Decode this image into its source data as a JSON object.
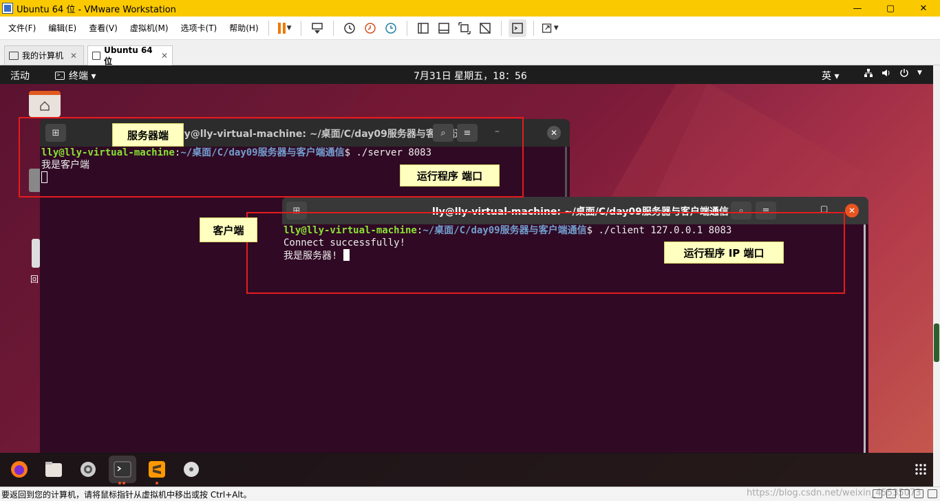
{
  "window": {
    "title": "Ubuntu 64 位 - VMware Workstation",
    "min": "—",
    "max": "▢",
    "close": "✕"
  },
  "menu": [
    "文件(F)",
    "编辑(E)",
    "查看(V)",
    "虚拟机(M)",
    "选项卡(T)",
    "帮助(H)"
  ],
  "tabs": [
    {
      "label": "我的计算机",
      "close": "✕"
    },
    {
      "label": "Ubuntu 64 位",
      "close": "✕"
    }
  ],
  "ubuntu": {
    "activities": "活动",
    "app_menu": "终端 ▾",
    "clock": "7月31日 星期五，18：56",
    "input_lang": "英 ▾",
    "desk_label": "回"
  },
  "server_terminal": {
    "title": "lly@lly-virtual-machine: ~/桌面/C/day09服务器与客户端通信",
    "prompt_user": "lly@lly-virtual-machine",
    "prompt_sep": ":",
    "prompt_path": "~/桌面/C/day09服务器与客户端通信",
    "command": "$ ./server 8083",
    "output": "我是客户端"
  },
  "client_terminal": {
    "title": "lly@lly-virtual-machine: ~/桌面/C/day09服务器与客户端通信",
    "prompt_user": "lly@lly-virtual-machine",
    "prompt_sep": ":",
    "prompt_path": "~/桌面/C/day09服务器与客户端通信",
    "command": "$ ./client 127.0.0.1 8083",
    "output1": "Connect successfully!",
    "output2": "我是服务器! "
  },
  "annotations": {
    "server": "服务器端",
    "server_run": "运行程序  端口",
    "client": "客户端",
    "client_run": "运行程序  IP  端口"
  },
  "status": {
    "message": "要返回到您的计算机，请将鼠标指针从虚拟机中移出或按 Ctrl+Alt。",
    "watermark": "https://blog.csdn.net/weixin_45535073"
  },
  "colors": {
    "accent_vmware": "#fbc900",
    "terminal_bg": "#300a24",
    "annotation_red": "#e51c1c",
    "ubuntu_orange": "#e95420"
  },
  "icons": [
    "power-pause-icon",
    "send-keys-icon",
    "snapshot-icon",
    "revert-snapshot-icon",
    "manage-snapshots-icon",
    "view-icons",
    "console-icon",
    "fullscreen-icon",
    "firefox-icon",
    "files-icon",
    "settings-icon",
    "terminal-icon",
    "sublime-icon",
    "dvd-icon",
    "app-grid-icon"
  ]
}
